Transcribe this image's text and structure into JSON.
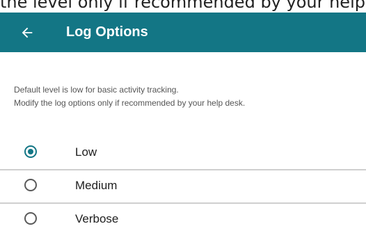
{
  "clipped_top_text": "the level only if recommended by your help desk.",
  "header": {
    "title": "Log Options",
    "back_icon": "arrow-left-icon",
    "background_color": "#137685"
  },
  "description": {
    "line1": "Default level is low for basic activity tracking.",
    "line2": "Modify the log options only if recommended by your help desk."
  },
  "log_level": {
    "selected": "Low",
    "options": [
      {
        "label": "Low",
        "selected": true
      },
      {
        "label": "Medium",
        "selected": false
      },
      {
        "label": "Verbose",
        "selected": false
      }
    ]
  }
}
